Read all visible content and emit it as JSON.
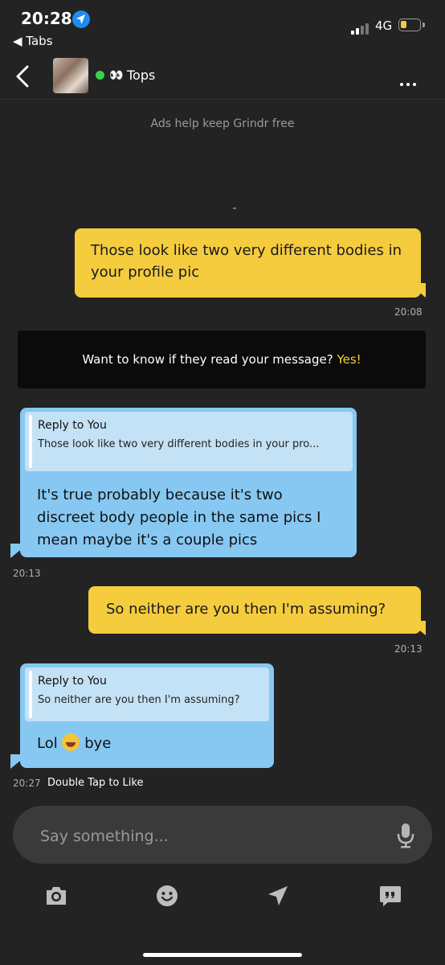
{
  "status_bar": {
    "time": "20:28",
    "back_app": "◀ Tabs",
    "network": "4G",
    "battery_level": 0.25
  },
  "header": {
    "eyes": "👀",
    "name": "Tops",
    "online": true
  },
  "ad_notice": "Ads help keep Grindr free",
  "messages": [
    {
      "text": "Those look like two very different bodies in your profile pic",
      "time": "20:08"
    },
    {
      "reply_title": "Reply to You",
      "reply_quote": "Those look like two very different bodies in your pro...",
      "text": "It's true probably because it's two discreet body people in the same pics I mean maybe it's a couple pics",
      "time": "20:13"
    },
    {
      "text": "So neither are you then I'm assuming?",
      "time": "20:13"
    },
    {
      "reply_title": "Reply to You",
      "reply_quote": "So neither are you then I'm assuming?",
      "text_before": "Lol",
      "text_after": "bye",
      "time": "20:27",
      "hint": "Double Tap to Like"
    }
  ],
  "read_receipt_banner": {
    "text": "Want to know if they read your message?",
    "cta": "Yes!"
  },
  "composer": {
    "placeholder": "Say something..."
  },
  "colors": {
    "background": "#232323",
    "outgoing": "#f5cc3e",
    "incoming": "#87c8f2",
    "accent": "#f5cc3e"
  }
}
